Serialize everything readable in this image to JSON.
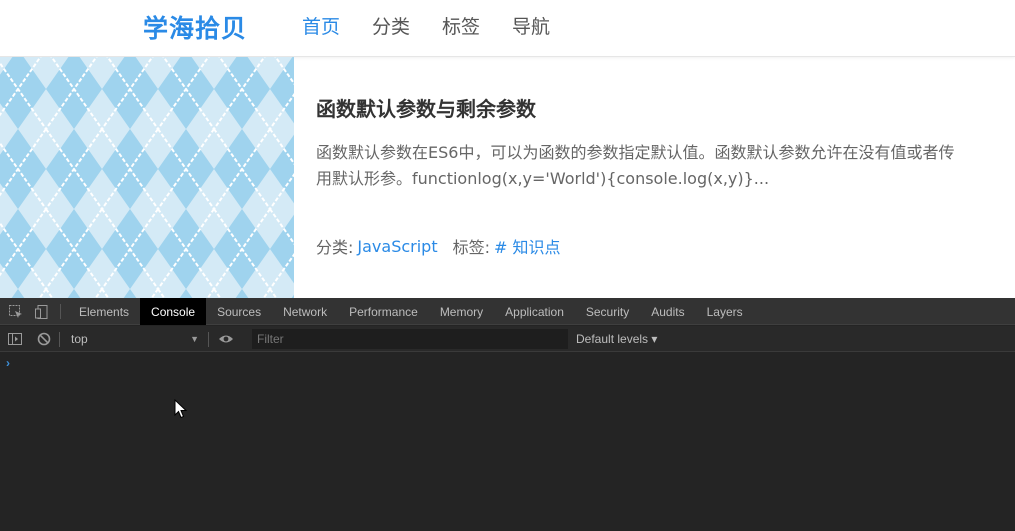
{
  "site": {
    "logo": "学海拾贝",
    "nav": [
      {
        "label": "首页",
        "active": true
      },
      {
        "label": "分类",
        "active": false
      },
      {
        "label": "标签",
        "active": false
      },
      {
        "label": "导航",
        "active": false
      }
    ]
  },
  "post": {
    "title": "函数默认参数与剩余参数",
    "excerpt_line1": "函数默认参数在ES6中，可以为函数的参数指定默认值。函数默认参数允许在没有值或者传",
    "excerpt_line2": "用默认形参。functionlog(x,y='World'){console.log(x,y)}...",
    "category_label": "分类:",
    "category": "JavaScript",
    "tag_label": "标签:",
    "tag": "# 知识点"
  },
  "devtools": {
    "tabs": [
      "Elements",
      "Console",
      "Sources",
      "Network",
      "Performance",
      "Memory",
      "Application",
      "Security",
      "Audits",
      "Layers"
    ],
    "active_tab": "Console",
    "context": "top",
    "filter_placeholder": "Filter",
    "levels": "Default levels ▾",
    "prompt": "›"
  },
  "colors": {
    "accent": "#2a8ae6",
    "devtools_bg": "#242424",
    "argyle_dark": "#9fd3ee",
    "argyle_light": "#d4eaf6"
  }
}
